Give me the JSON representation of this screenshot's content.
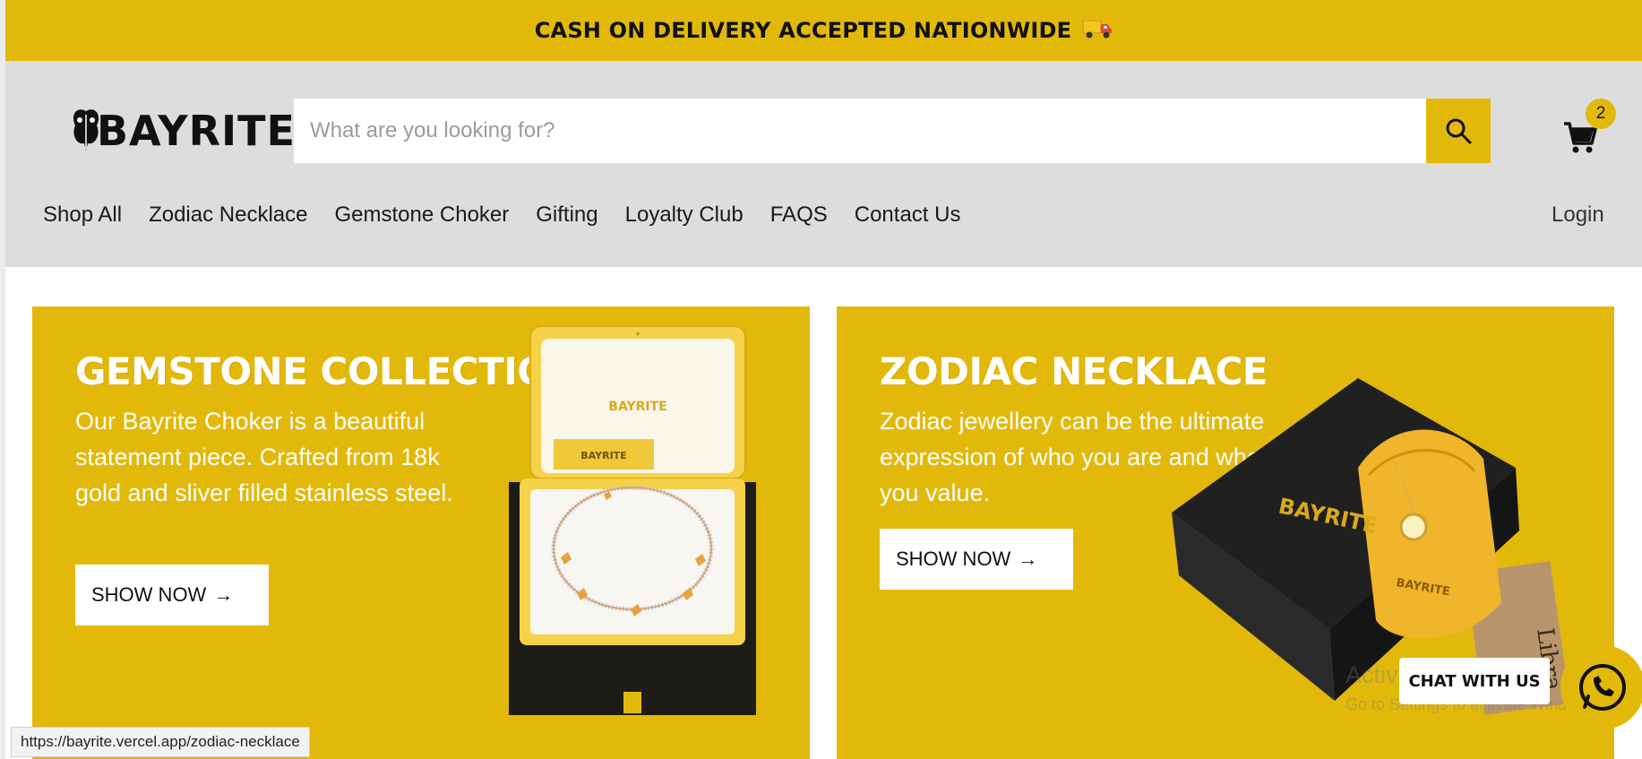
{
  "announcement": {
    "text": "CASH ON DELIVERY ACCEPTED NATIONWIDE"
  },
  "header": {
    "logo": "BAYRITE",
    "search_placeholder": "What are you looking for?",
    "cart_count": "2",
    "login": "Login"
  },
  "nav": {
    "items": [
      "Shop All",
      "Zodiac Necklace",
      "Gemstone Choker",
      "Gifting",
      "Loyalty Club",
      "FAQS",
      "Contact Us"
    ]
  },
  "cards": [
    {
      "title": "GEMSTONE COLLECTION",
      "description": "Our Bayrite Choker is a beautiful statement piece. Crafted from 18k gold and sliver filled stainless steel.",
      "button": "SHOW NOW",
      "image_brand": "BAYRITE"
    },
    {
      "title": "ZODIAC NECKLACE",
      "description": "Zodiac jewellery can be the ultimate expression of who you are and what you value.",
      "button": "SHOW NOW",
      "image_brand": "BAYRITE",
      "image_tag": "Libra"
    }
  ],
  "chat": {
    "label": "CHAT WITH US"
  },
  "watermark": {
    "title": "Activate Windows",
    "subtitle": "Go to Settings to activate Windows."
  },
  "status_url": "https://bayrite.vercel.app/zodiac-necklace",
  "colors": {
    "accent": "#e2b90b",
    "header_bg": "#dddddd"
  }
}
